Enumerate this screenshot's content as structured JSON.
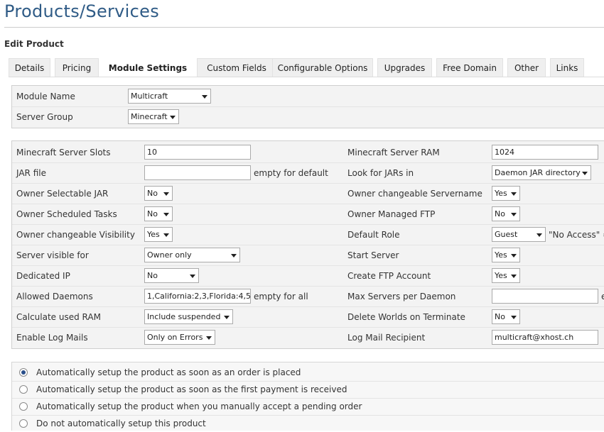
{
  "page": {
    "title": "Products/Services",
    "subtitle": "Edit Product"
  },
  "tabs": [
    {
      "label": "Details"
    },
    {
      "label": "Pricing"
    },
    {
      "label": "Module Settings",
      "active": true
    },
    {
      "label": "Custom Fields"
    },
    {
      "label": "Configurable Options"
    },
    {
      "label": "Upgrades"
    },
    {
      "label": "Free Domain"
    },
    {
      "label": "Other"
    },
    {
      "label": "Links"
    }
  ],
  "module": {
    "name_label": "Module Name",
    "name_value": "Multicraft",
    "group_label": "Server Group",
    "group_value": "Minecraft"
  },
  "settings": {
    "left": [
      {
        "label": "Minecraft Server Slots",
        "type": "input",
        "value": "10"
      },
      {
        "label": "JAR file",
        "type": "input",
        "value": "",
        "hint": "empty for default"
      },
      {
        "label": "Owner Selectable JAR",
        "type": "select",
        "value": "No"
      },
      {
        "label": "Owner Scheduled Tasks",
        "type": "select",
        "value": "No"
      },
      {
        "label": "Owner changeable Visibility",
        "type": "select",
        "value": "Yes"
      },
      {
        "label": "Server visible for",
        "type": "select",
        "value": "Owner only"
      },
      {
        "label": "Dedicated IP",
        "type": "select",
        "value": "No"
      },
      {
        "label": "Allowed Daemons",
        "type": "input",
        "value": "1,California:2,3,Florida:4,5",
        "hint": "empty for all"
      },
      {
        "label": "Calculate used RAM",
        "type": "select",
        "value": "Include suspended"
      },
      {
        "label": "Enable Log Mails",
        "type": "select",
        "value": "Only on Errors"
      }
    ],
    "right": [
      {
        "label": "Minecraft Server RAM",
        "type": "input",
        "value": "1024"
      },
      {
        "label": "Look for JARs in",
        "type": "select",
        "value": "Daemon JAR directory"
      },
      {
        "label": "Owner changeable Servername",
        "type": "select",
        "value": "Yes"
      },
      {
        "label": "Owner Managed FTP",
        "type": "select",
        "value": "No"
      },
      {
        "label": "Default Role",
        "type": "select",
        "value": "Guest",
        "hint": "\"No Access\" ="
      },
      {
        "label": "Start Server",
        "type": "select",
        "value": "Yes"
      },
      {
        "label": "Create FTP Account",
        "type": "select",
        "value": "Yes"
      },
      {
        "label": "Max Servers per Daemon",
        "type": "input",
        "value": "",
        "hint": "e"
      },
      {
        "label": "Delete Worlds on Terminate",
        "type": "select",
        "value": "No"
      },
      {
        "label": "Log Mail Recipient",
        "type": "input",
        "value": "multicraft@xhost.ch"
      }
    ]
  },
  "setup_options": [
    {
      "label": "Automatically setup the product as soon as an order is placed",
      "checked": true
    },
    {
      "label": "Automatically setup the product as soon as the first payment is received",
      "checked": false
    },
    {
      "label": "Automatically setup the product when you manually accept a pending order",
      "checked": false
    },
    {
      "label": "Do not automatically setup this product",
      "checked": false
    }
  ]
}
